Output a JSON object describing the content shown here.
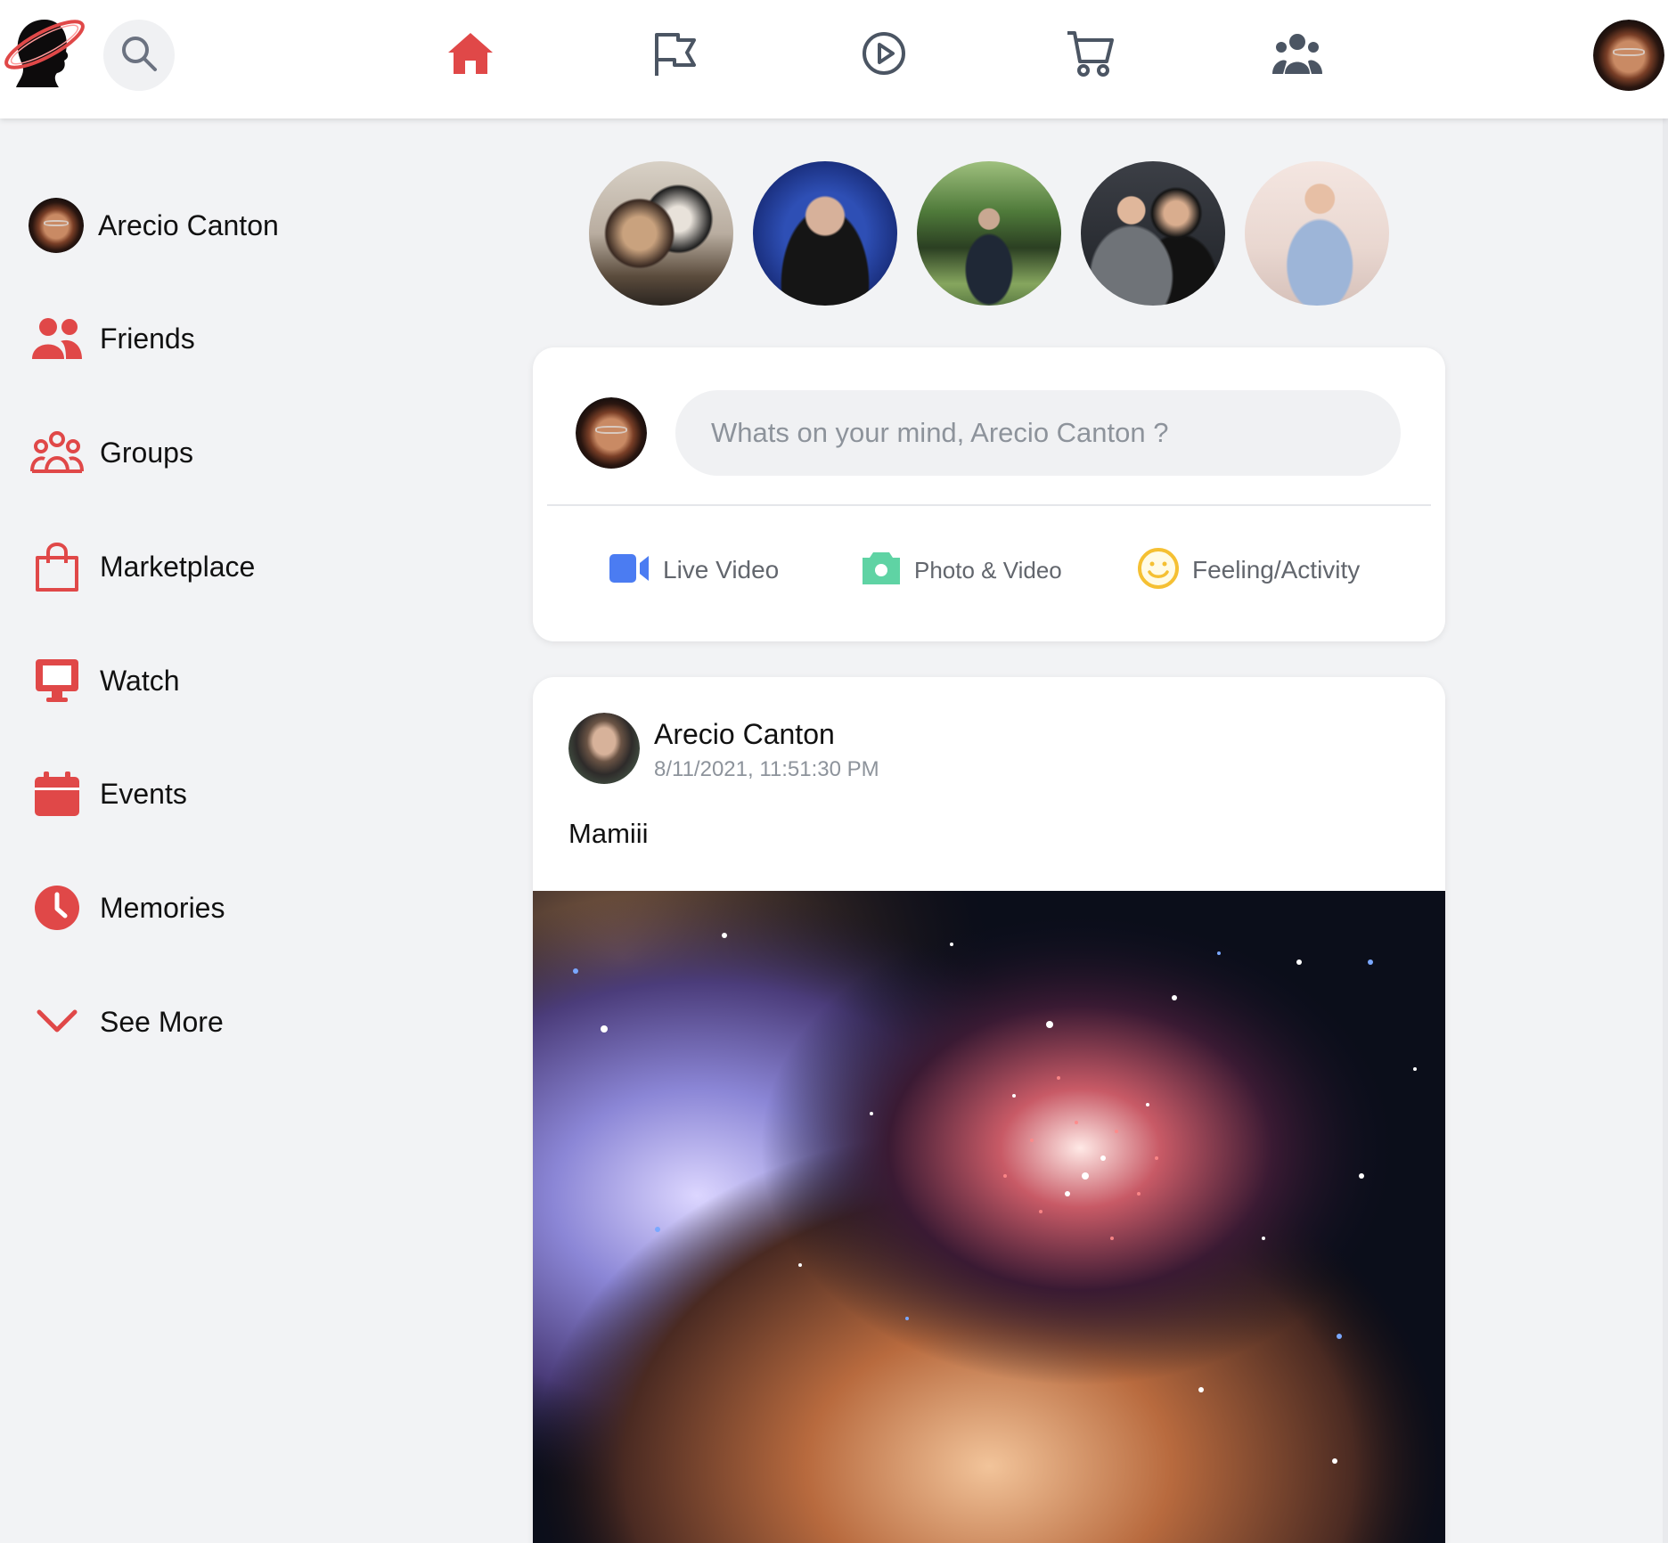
{
  "topbar": {
    "logo_icon": "saturn-head-logo",
    "search_icon": "search-icon",
    "nav_icons": [
      "home-icon",
      "flag-icon",
      "play-circle-icon",
      "cart-icon",
      "people-group-icon"
    ],
    "active_nav": "home-icon"
  },
  "sidebar": {
    "profile_name": "Arecio Canton",
    "items": [
      {
        "label": "Friends",
        "icon": "friends-icon"
      },
      {
        "label": "Groups",
        "icon": "groups-icon"
      },
      {
        "label": "Marketplace",
        "icon": "shopping-bag-icon"
      },
      {
        "label": "Watch",
        "icon": "monitor-icon"
      },
      {
        "label": "Events",
        "icon": "calendar-icon"
      },
      {
        "label": "Memories",
        "icon": "clock-icon"
      },
      {
        "label": "See More",
        "icon": "chevron-down-icon"
      }
    ]
  },
  "stories": [
    "story-1",
    "story-2",
    "story-3",
    "story-4",
    "story-5"
  ],
  "composer": {
    "placeholder": "Whats on your mind, Arecio Canton ?",
    "actions": [
      {
        "label": "Live Video",
        "icon": "video-camera-icon",
        "color": "#4b7cf2"
      },
      {
        "label": "Photo & Video",
        "icon": "photo-camera-icon",
        "color": "#5fd3a4"
      },
      {
        "label": "Feeling/Activity",
        "icon": "smiley-icon",
        "color": "#f5c033"
      }
    ]
  },
  "post": {
    "author": "Arecio Canton",
    "timestamp": "8/11/2021, 11:51:30 PM",
    "text": "Mamiii",
    "image": "nebula-star-cluster-image"
  },
  "colors": {
    "accent": "#e04848",
    "icon_gray": "#4b5563",
    "background": "#f2f3f5"
  }
}
